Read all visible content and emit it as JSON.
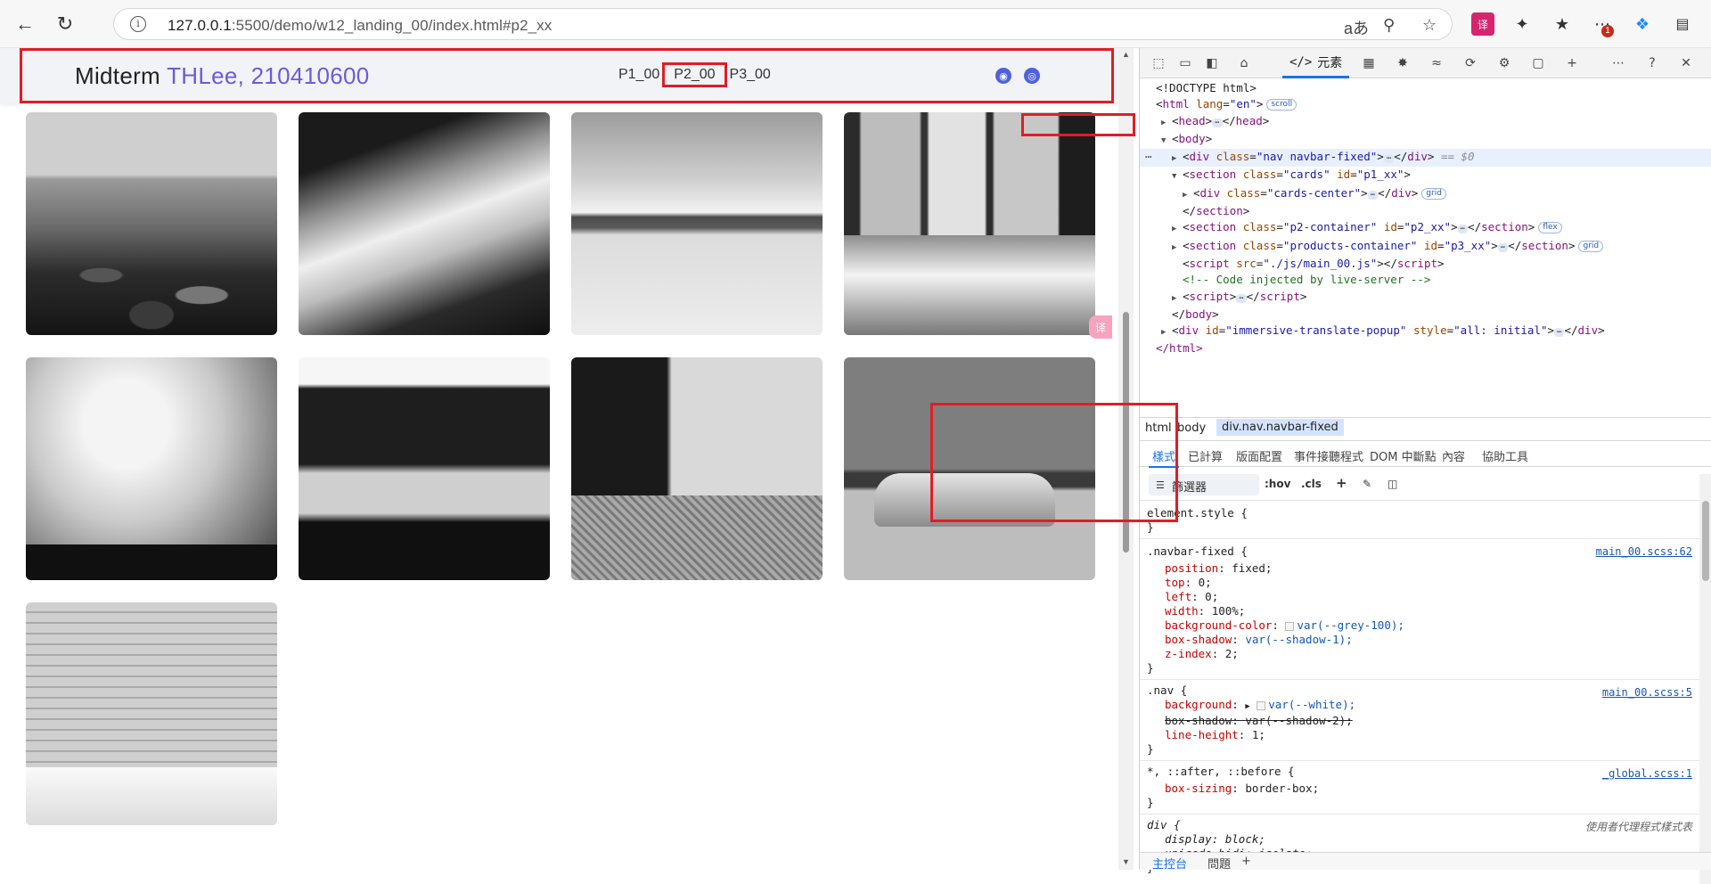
{
  "browser": {
    "url_host": "127.0.0.1",
    "url_path": ":5500/demo/w12_landing_00/index.html#p2_xx",
    "notification_count": "1"
  },
  "page": {
    "brand_title": "Midterm",
    "brand_author": "THLee, 210410600",
    "nav_links": [
      "P1_00",
      "P2_00",
      "P3_00"
    ],
    "active_link": "P2_00",
    "translate_badge": "译"
  },
  "devtools": {
    "active_tab": "元素",
    "tree": {
      "doctype": "<!DOCTYPE html>",
      "html_open": "html",
      "html_lang_attr": "lang",
      "html_lang_val": "\"en\"",
      "scroll_pill": "scroll",
      "head": "head",
      "body": "body",
      "div_nav_attr": "class",
      "div_nav_val": "\"nav navbar-fixed\"",
      "selected_marker": "== $0",
      "section_cards_class": "\"cards\"",
      "section_cards_id": "\"p1_xx\"",
      "div_cards_center_class": "\"cards-center\"",
      "grid_pill": "grid",
      "section_p2_class": "\"p2-container\"",
      "section_p2_id": "\"p2_xx\"",
      "flex_pill": "flex",
      "section_p3_class": "\"products-container\"",
      "section_p3_id": "\"p3_xx\"",
      "script_src": "\"./js/main_00.js\"",
      "comment": "<!-- Code injected by live-server -->",
      "popup_id": "\"immersive-translate-popup\"",
      "popup_style": "\"all: initial\"",
      "close_html": "</html>"
    },
    "breadcrumbs": [
      "html",
      "body",
      "div.nav.navbar-fixed"
    ],
    "subtabs": [
      "樣式",
      "已計算",
      "版面配置",
      "事件接聽程式",
      "DOM 中斷點",
      "內容",
      "協助工具"
    ],
    "filter_placeholder": "篩選器",
    "filter_options": [
      ":hov",
      ".cls"
    ],
    "rules": {
      "element_style": "element.style {",
      "navbar_selector": ".navbar-fixed {",
      "navbar_src": "main_00.scss:62",
      "navbar_decls": [
        {
          "p": "position",
          "v": "fixed;"
        },
        {
          "p": "top",
          "v": "0;"
        },
        {
          "p": "left",
          "v": "0;"
        },
        {
          "p": "width",
          "v": "100%;"
        },
        {
          "p": "background-color",
          "v": "var(--grey-100);"
        },
        {
          "p": "box-shadow",
          "v": "var(--shadow-1);"
        },
        {
          "p": "z-index",
          "v": "2;"
        }
      ],
      "nav_selector": ".nav {",
      "nav_src": "main_00.scss:5",
      "nav_decls": [
        {
          "p": "background",
          "v": "var(--white);"
        },
        {
          "p": "box-shadow",
          "v": "var(--shadow-2);"
        },
        {
          "p": "line-height",
          "v": "1;"
        }
      ],
      "universal_selector": "*, ::after, ::before {",
      "universal_src": "_global.scss:1",
      "universal_decl": {
        "p": "box-sizing",
        "v": "border-box;"
      },
      "div_selector": "div {",
      "div_src": "使用者代理程式樣式表",
      "div_decls": [
        {
          "p": "display",
          "v": "block;"
        },
        {
          "p": "unicode-bidi",
          "v": "isolate;"
        }
      ],
      "close": "}"
    },
    "drawer_tabs": [
      "主控台",
      "問題"
    ]
  },
  "colors": {
    "highlight_red": "#e11d24",
    "brand_purple": "#6b5bd9",
    "devtools_blue": "#1a73e8"
  }
}
